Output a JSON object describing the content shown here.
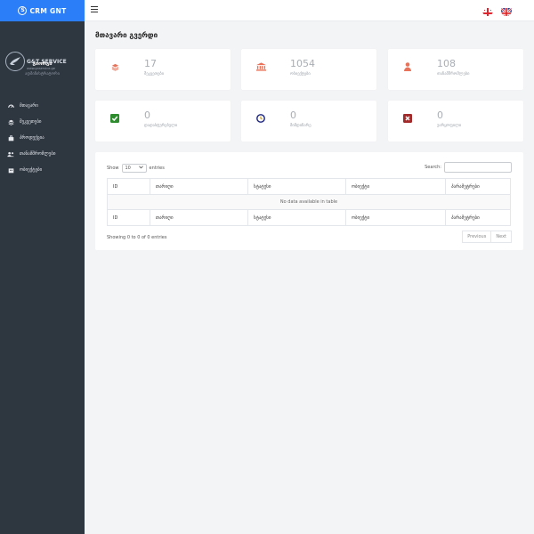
{
  "brand": {
    "name": "CRM GNT",
    "icon": "s-logo-icon",
    "color": "#2c7ef8"
  },
  "company": {
    "name": "G&T SERVICE",
    "url": "www.gnservice.ge"
  },
  "user": {
    "name": "გიორგი",
    "role": "ადმინისტრატორი"
  },
  "nav": [
    {
      "label": "მთავარი",
      "icon": "speedometer-icon"
    },
    {
      "label": "შეკვეთები",
      "icon": "layers-icon"
    },
    {
      "label": "პროდუქცია",
      "icon": "briefcase-icon"
    },
    {
      "label": "თანამშრომლები",
      "icon": "users-icon"
    },
    {
      "label": "ობიექტები",
      "icon": "building-icon"
    }
  ],
  "topbar": {
    "menu_icon": "hamburger-icon",
    "languages": [
      "georgian-flag-icon",
      "uk-flag-icon"
    ]
  },
  "page": {
    "title": "მთავარი გვერდი"
  },
  "stats": [
    {
      "count": "17",
      "label": "შეკვეთები",
      "icon": "layers-icon",
      "color": "#e8735a"
    },
    {
      "count": "1054",
      "label": "ობიექტები",
      "icon": "bank-icon",
      "color": "#e8735a"
    },
    {
      "count": "108",
      "label": "თანამშრომლები",
      "icon": "user-icon",
      "color": "#e8735a"
    },
    {
      "count": "0",
      "label": "დადასტურებული",
      "icon": "check-square-icon",
      "color": "#2e8b2e"
    },
    {
      "count": "0",
      "label": "მიმდინარე",
      "icon": "clock-icon",
      "color": "#1a237e"
    },
    {
      "count": "0",
      "label": "უარყოფილი",
      "icon": "x-square-icon",
      "color": "#a32a2a"
    }
  ],
  "table": {
    "show_label": "Show",
    "page_size": "10",
    "entries_label": "entries",
    "search_label": "Search:",
    "columns": [
      "ID",
      "თარიღი",
      "სტატუსი",
      "ობიექტი",
      "პარამეტრები"
    ],
    "empty_text": "No data available in table",
    "info": "Showing 0 to 0 of 0 entries",
    "prev_label": "Previous",
    "next_label": "Next"
  }
}
